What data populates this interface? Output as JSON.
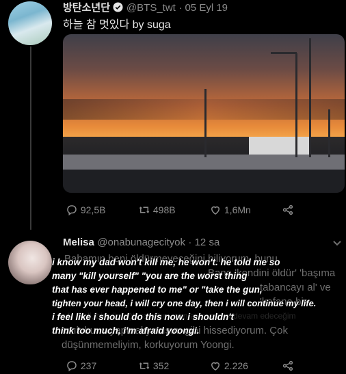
{
  "tweet1": {
    "name": "방탄소년단",
    "handle": "@BTS_twt",
    "date": "05 Eyl 19",
    "text": "하늘 참 멋있다 by suga",
    "reply_count": "92,5B",
    "retweet_count": "498B",
    "like_count": "1,6Mn"
  },
  "tweet2": {
    "name": "Melisa",
    "handle": "@onabunagecityok",
    "time": "12 sa",
    "ghost_lines": [
      "Babamın beni öldürmeyeceğini biliyorum, bunu",
      "Bana 'kendini öldür' 'başıma",
      "tabancayı al' ve 'kafana bir",
      "sık' dedi, bir gün ağlayacağım, sonra hayatıma devam edeceğim",
      "artık bunu yapmalıyımışım gibi hissediyorum. Çok",
      "düşünmemeliyim, korkuyorum Yoongi."
    ],
    "caption_lines": [
      "i know my dad won't kill me, he won't. he told me so",
      "many \"kill yourself\" \"you are the worst thing",
      "that has ever happened to me\" or \"take the gun,",
      "tighten your head, i will cry one day, then i will continue my life.",
      "i feel like i should do this now. i shouldn't",
      "think too much, i'm afraid yoongi."
    ],
    "reply_count": "237",
    "retweet_count": "352",
    "like_count": "2.226"
  },
  "icons": {
    "verified": "verified-badge-icon",
    "reply": "reply-icon",
    "retweet": "retweet-icon",
    "like": "heart-icon",
    "share": "share-icon",
    "more": "chevron-down-icon"
  }
}
